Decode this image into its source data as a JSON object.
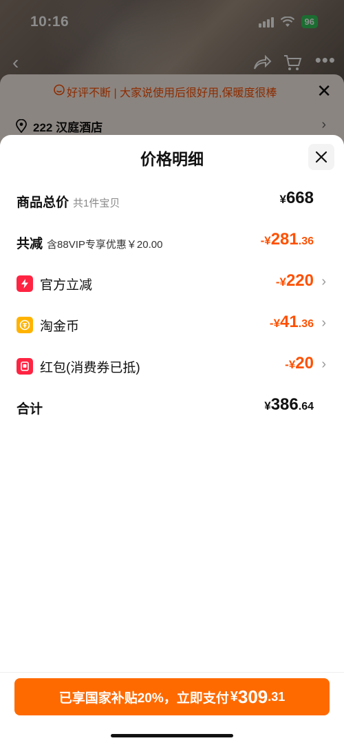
{
  "status_bar": {
    "time": "10:16",
    "battery": "96"
  },
  "banner": {
    "review_text": "好评不断 | 大家说使用后很好用,保暖度很棒",
    "address": "222 汉庭酒店"
  },
  "sheet": {
    "title": "价格明细",
    "total_goods": {
      "label": "商品总价",
      "sub": "共1件宝贝",
      "currency": "¥",
      "amount": "668"
    },
    "total_discount": {
      "label": "共减",
      "sub": "含88VIP专享优惠￥20.00",
      "currency": "-¥",
      "int": "281",
      "dec": ".36"
    },
    "discounts": [
      {
        "label": "官方立减",
        "currency": "-¥",
        "int": "220",
        "dec": ""
      },
      {
        "label": "淘金币",
        "currency": "-¥",
        "int": "41",
        "dec": ".36"
      },
      {
        "label": "红包(消费券已抵)",
        "currency": "-¥",
        "int": "20",
        "dec": ""
      }
    ],
    "sum": {
      "label": "合计",
      "currency": "¥",
      "int": "386",
      "dec": ".64"
    }
  },
  "pay_button": {
    "text": "已享国家补贴20%，立即支付",
    "currency": "¥",
    "int": "309",
    "dec": ".31"
  },
  "colors": {
    "accent": "#ff5000",
    "pay_button": "#ff6a00",
    "coin": "#ffb300",
    "red_icon": "#ff2442"
  },
  "icons": [
    "back-icon",
    "share-icon",
    "cart-icon",
    "more-icon",
    "review-chat-icon",
    "location-pin-icon",
    "lightning-icon",
    "coin-icon",
    "red-packet-icon",
    "close-icon",
    "chevron-right-icon"
  ]
}
